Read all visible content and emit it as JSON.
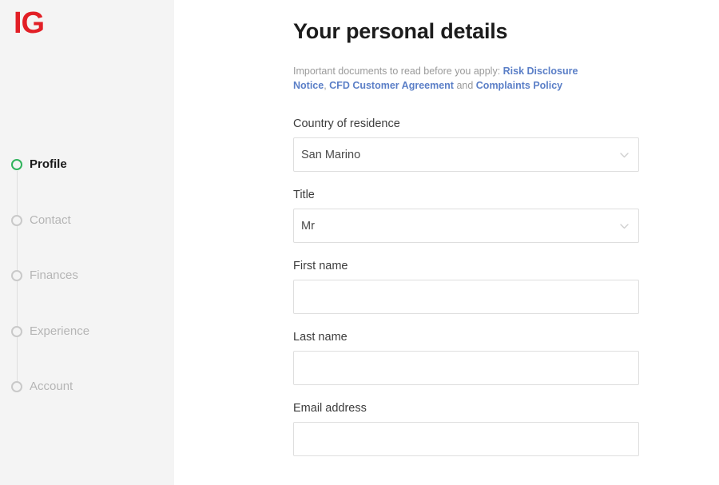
{
  "brand": {
    "logo_text": "IG",
    "logo_color": "#e21f26",
    "accent_active": "#30b35c",
    "link_color": "#5b7fc7"
  },
  "sidebar": {
    "steps": [
      {
        "label": "Profile",
        "state": "active"
      },
      {
        "label": "Contact",
        "state": "inactive"
      },
      {
        "label": "Finances",
        "state": "inactive"
      },
      {
        "label": "Experience",
        "state": "inactive"
      },
      {
        "label": "Account",
        "state": "inactive"
      }
    ]
  },
  "main": {
    "title": "Your personal details",
    "disclaimer": {
      "intro": "Important documents to read before you apply: ",
      "link1": "Risk Disclosure Notice",
      "sep1": ", ",
      "link2": "CFD Customer Agreement",
      "sep2": " and ",
      "link3": "Complaints Policy"
    },
    "fields": {
      "country": {
        "label": "Country of residence",
        "value": "San Marino",
        "icon": "chevron-down-icon"
      },
      "title": {
        "label": "Title",
        "value": "Mr",
        "icon": "chevron-down-icon"
      },
      "first_name": {
        "label": "First name",
        "value": "",
        "placeholder": ""
      },
      "last_name": {
        "label": "Last name",
        "value": "",
        "placeholder": ""
      },
      "email": {
        "label": "Email address",
        "value": "",
        "placeholder": ""
      }
    }
  }
}
